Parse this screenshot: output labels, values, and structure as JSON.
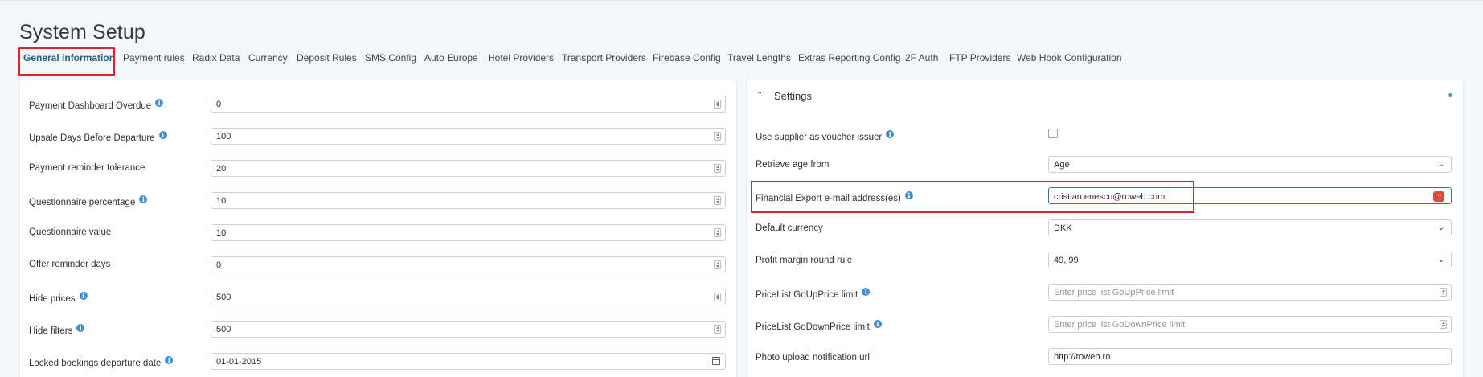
{
  "page": {
    "title": "System Setup"
  },
  "tabs": [
    {
      "label": "General information",
      "active": true
    },
    {
      "label": "Payment rules"
    },
    {
      "label": "Radix Data"
    },
    {
      "label": "Currency"
    },
    {
      "label": "Deposit Rules"
    },
    {
      "label": "SMS Config"
    },
    {
      "label": "Auto Europe"
    },
    {
      "label": "Hotel Providers"
    },
    {
      "label": "Transport Providers"
    },
    {
      "label": "Firebase Config"
    },
    {
      "label": "Travel Lengths"
    },
    {
      "label": "Extras Reporting Config"
    },
    {
      "label": "2F Auth"
    },
    {
      "label": "FTP Providers"
    },
    {
      "label": "Web Hook Configuration"
    }
  ],
  "left_fields": [
    {
      "label": "Payment Dashboard Overdue",
      "value": "0",
      "info": true
    },
    {
      "label": "Upsale Days Before Departure",
      "value": "100",
      "info": true
    },
    {
      "label": "Payment reminder tolerance",
      "value": "20",
      "info": false
    },
    {
      "label": "Questionnaire percentage",
      "value": "10",
      "info": true
    },
    {
      "label": "Questionnaire value",
      "value": "10",
      "info": false
    },
    {
      "label": "Offer reminder days",
      "value": "0",
      "info": false
    },
    {
      "label": "Hide prices",
      "value": "500",
      "info": true
    },
    {
      "label": "Hide filters",
      "value": "500",
      "info": true
    },
    {
      "label": "Locked bookings departure date",
      "value": "01-01-2015",
      "info": true
    }
  ],
  "settings": {
    "title": "Settings",
    "use_supplier": {
      "label": "Use supplier as voucher issuer",
      "checked": false
    },
    "retrieve_age": {
      "label": "Retrieve age from",
      "value": "Age"
    },
    "financial_export": {
      "label": "Financial Export e-mail address(es)",
      "value": "cristian.enescu@roweb.com"
    },
    "default_currency": {
      "label": "Default currency",
      "value": "DKK"
    },
    "profit_margin": {
      "label": "Profit margin round rule",
      "value": "49, 99"
    },
    "goup_limit": {
      "label": "PriceList GoUpPrice limit",
      "placeholder": "Enter price list GoUpPrice limit"
    },
    "godown_limit": {
      "label": "PriceList GoDownPrice limit",
      "placeholder": "Enter price list GoDownPrice limit"
    },
    "photo_url": {
      "label": "Photo upload notification url",
      "value": "http://roweb.ro"
    }
  },
  "colors": {
    "accent": "#1f5f8b",
    "highlight": "#e0232a",
    "info": "#3b8fd6"
  }
}
